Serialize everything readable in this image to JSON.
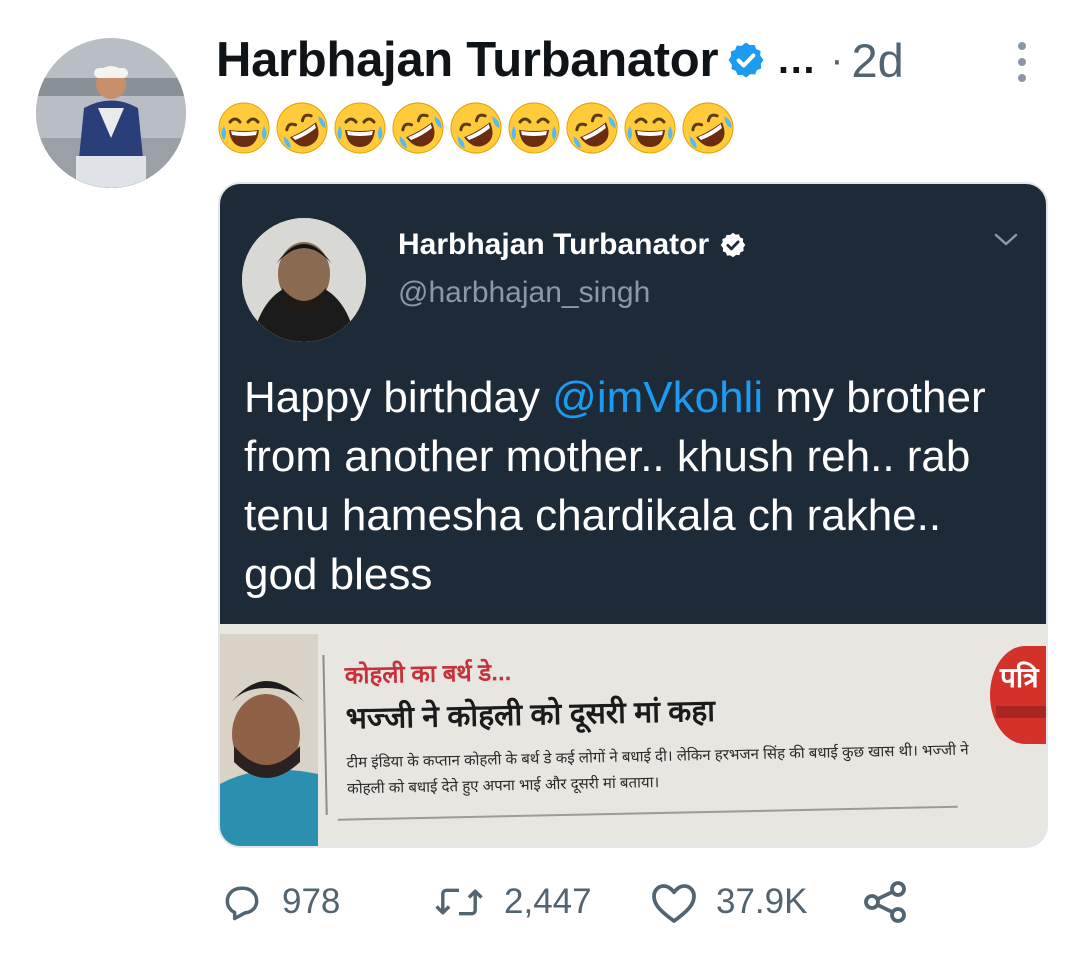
{
  "tweet": {
    "author_name": "Harbhajan Turbanator",
    "more_indicator": "…",
    "separator": "·",
    "timestamp": "2d",
    "emoji_text": "😂🤣😂🤣🤣😂🤣😂🤣",
    "emoji_sequence": [
      "joy",
      "rofl",
      "joy",
      "rofl",
      "rofl",
      "joy",
      "rofl",
      "joy",
      "rofl"
    ]
  },
  "embedded_tweet": {
    "author_name": "Harbhajan Turbanator",
    "handle": "@harbhajan_singh",
    "text_before": "Happy birthday ",
    "mention": "@imVkohli",
    "text_after": " my brother from another mother.. khush reh.. rab tenu hamesha chardikala ch rakhe.. god bless"
  },
  "newspaper_clip": {
    "kicker": "कोहली का बर्थ डे...",
    "headline": "भज्जी ने कोहली को दूसरी मां कहा",
    "body": "टीम इंडिया के कप्तान कोहली के बर्थ डे कई लोगों ने बधाई दी। लेकिन हरभजन सिंह की बधाई कुछ खास थी। भज्जी ने कोहली को बधाई देते हुए अपना भाई और दूसरी मां बताया।",
    "logo_text": "पत्रि"
  },
  "actions": {
    "replies": "978",
    "retweets": "2,447",
    "likes": "37.9K"
  },
  "colors": {
    "verified": "#1d9bf0",
    "mention": "#1d9bf0",
    "secondary_text": "#536471",
    "embedded_bg": "#1d2a38"
  },
  "icons": [
    "verified-badge-icon",
    "more-icon",
    "chevron-down-icon",
    "reply-icon",
    "retweet-icon",
    "like-icon",
    "share-icon"
  ]
}
